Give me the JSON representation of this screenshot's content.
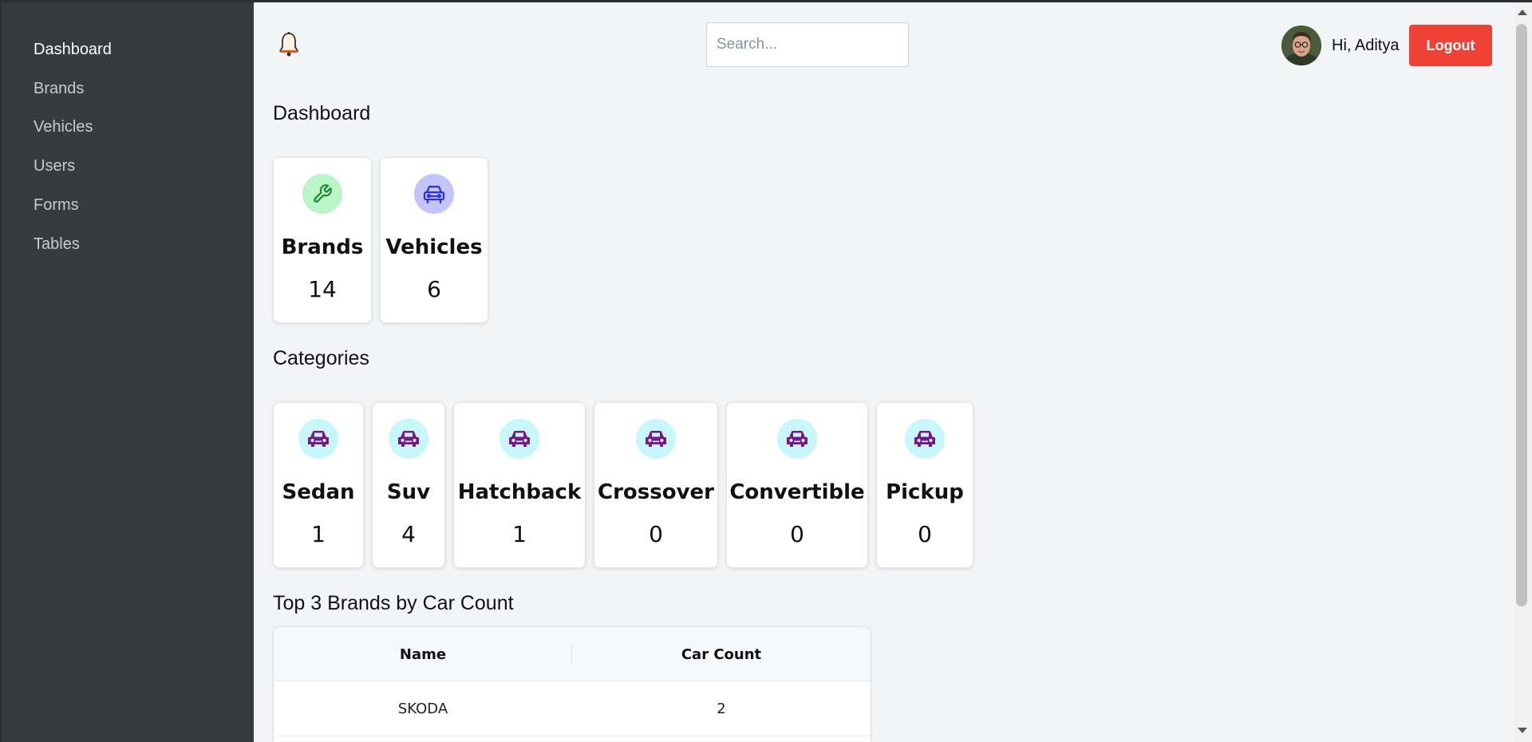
{
  "sidebar": {
    "items": [
      {
        "label": "Dashboard",
        "active": true
      },
      {
        "label": "Brands"
      },
      {
        "label": "Vehicles"
      },
      {
        "label": "Users"
      },
      {
        "label": "Forms"
      },
      {
        "label": "Tables"
      }
    ]
  },
  "header": {
    "bell_icon": "bell-icon",
    "search_placeholder": "Search...",
    "greeting": "Hi, Aditya",
    "logout_label": "Logout",
    "logout_color": "#ef4136"
  },
  "dashboard": {
    "title": "Dashboard",
    "stats": [
      {
        "label": "Brands",
        "count": "14",
        "icon": "wrench-icon",
        "icon_bg": "#b9f5c6",
        "icon_color": "#1a8a2c"
      },
      {
        "label": "Vehicles",
        "count": "6",
        "icon": "car-icon",
        "icon_bg": "#c3c4fb",
        "icon_color": "#2a2ee0"
      }
    ]
  },
  "categories": {
    "title": "Categories",
    "items": [
      {
        "label": "Sedan",
        "count": "1"
      },
      {
        "label": "Suv",
        "count": "4"
      },
      {
        "label": "Hatchback",
        "count": "1"
      },
      {
        "label": "Crossover",
        "count": "0"
      },
      {
        "label": "Convertible",
        "count": "0"
      },
      {
        "label": "Pickup",
        "count": "0"
      }
    ],
    "icon": "car-icon",
    "icon_bg": "#c8f7fb",
    "icon_color": "#7a1786"
  },
  "top_brands": {
    "title": "Top 3 Brands by Car Count",
    "columns": [
      "Name",
      "Car Count"
    ],
    "rows": [
      [
        "SKODA",
        "2"
      ]
    ]
  }
}
